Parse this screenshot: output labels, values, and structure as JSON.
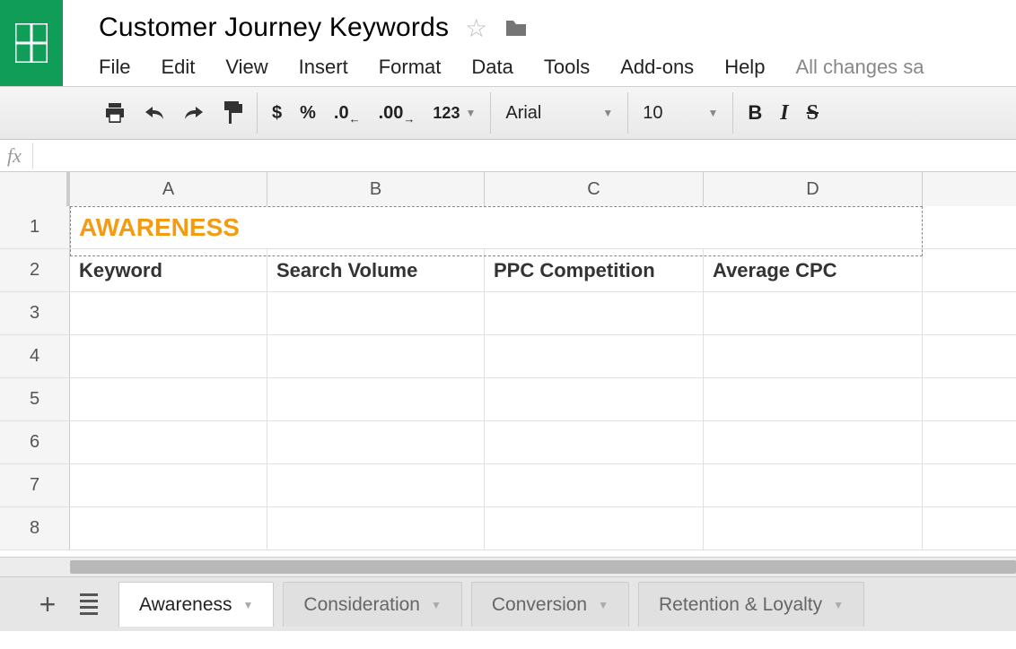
{
  "header": {
    "title": "Customer Journey Keywords",
    "menus": [
      "File",
      "Edit",
      "View",
      "Insert",
      "Format",
      "Data",
      "Tools",
      "Add-ons",
      "Help"
    ],
    "save_status": "All changes sa"
  },
  "toolbar": {
    "currency": "$",
    "percent": "%",
    "dec_decrease": ".0",
    "dec_increase": ".00",
    "format_123": "123",
    "font": "Arial",
    "font_size": "10",
    "bold": "B",
    "italic": "I",
    "strike": "S"
  },
  "formula_bar": {
    "fx_label": "fx"
  },
  "columns": [
    "A",
    "B",
    "C",
    "D"
  ],
  "rows": [
    "1",
    "2",
    "3",
    "4",
    "5",
    "6",
    "7",
    "8"
  ],
  "sheet": {
    "row1_title": "AWARENESS",
    "row2_headers": {
      "A": "Keyword",
      "B": "Search Volume",
      "C": "PPC Competition",
      "D": "Average CPC"
    }
  },
  "tabs": [
    {
      "label": "Awareness",
      "active": true
    },
    {
      "label": "Consideration",
      "active": false
    },
    {
      "label": "Conversion",
      "active": false
    },
    {
      "label": "Retention & Loyalty",
      "active": false
    }
  ]
}
